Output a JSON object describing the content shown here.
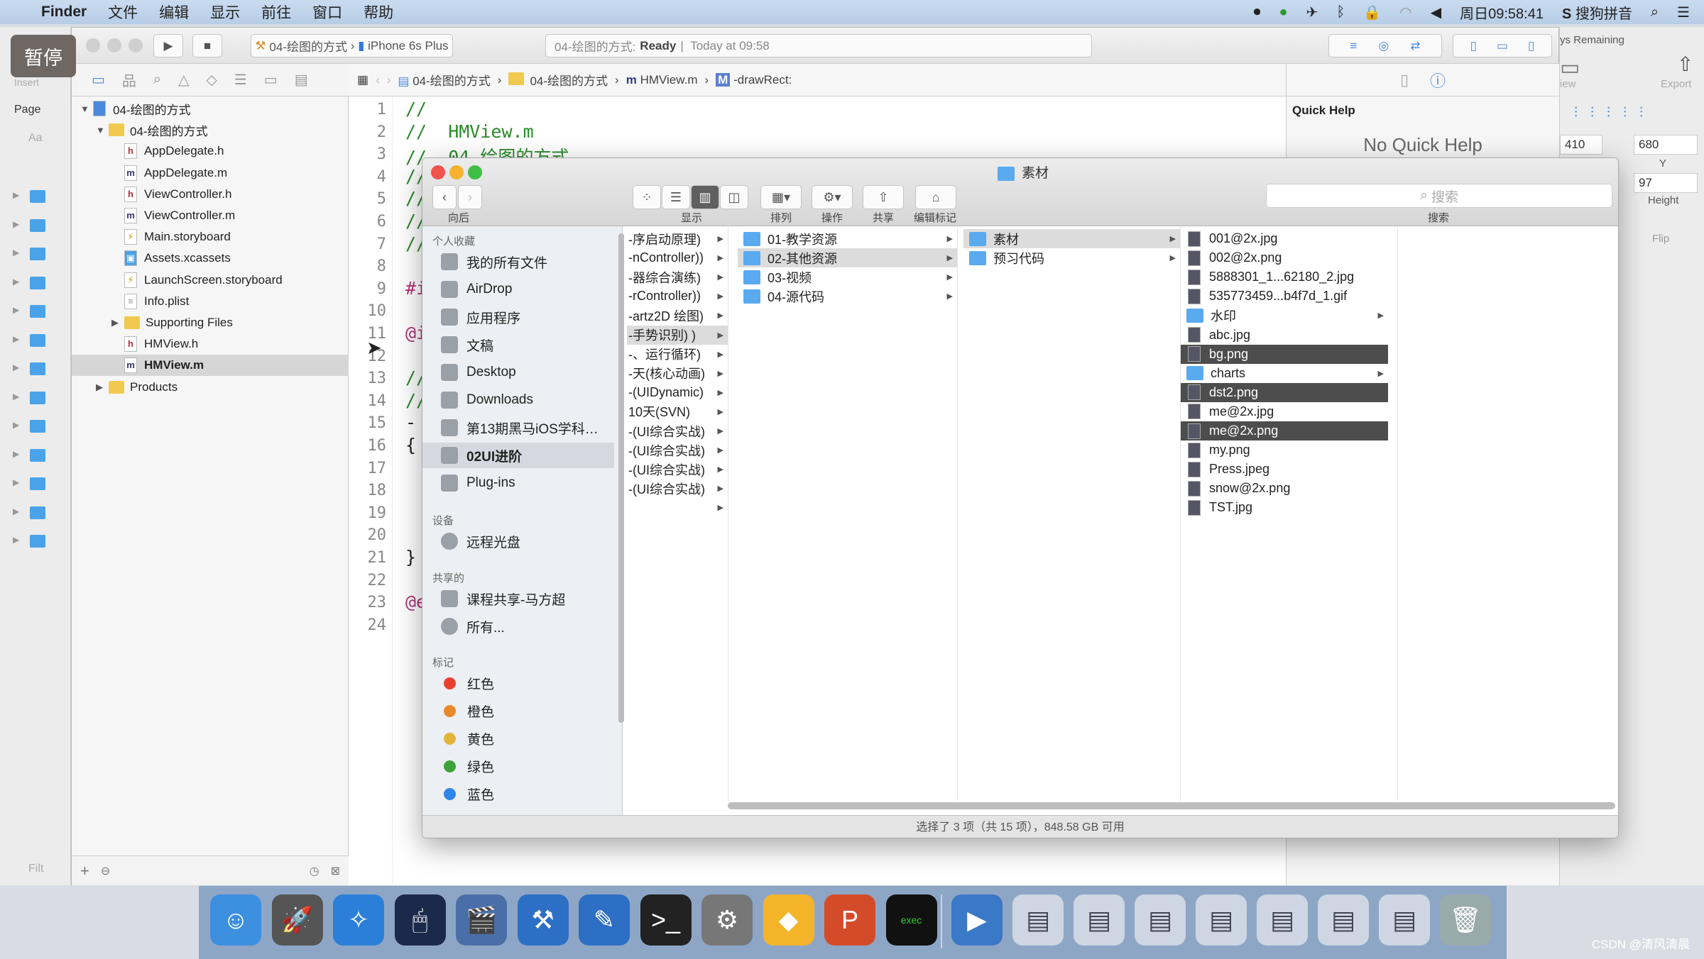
{
  "menubar": {
    "app": "Finder",
    "items": [
      "文件",
      "编辑",
      "显示",
      "前往",
      "窗口",
      "帮助"
    ],
    "clock": "周日09:58:41",
    "ime": "搜狗拼音"
  },
  "overlay": {
    "pause": "暂停",
    "watermark": "CSDN @清风清晨"
  },
  "bg_app": {
    "insert": "Insert",
    "page": "Page",
    "aa": "Aa",
    "filter": "Filt"
  },
  "xcode": {
    "scheme": "04-绘图的方式",
    "device": "iPhone 6s Plus",
    "status": {
      "project": "04-绘图的方式:",
      "state": "Ready",
      "time": "Today at 09:58"
    },
    "jumpbar": [
      "04-绘图的方式",
      "04-绘图的方式",
      "HMView.m",
      "-drawRect:"
    ],
    "navigator": [
      {
        "label": "04-绘图的方式",
        "kind": "project",
        "depth": 0,
        "open": true
      },
      {
        "label": "04-绘图的方式",
        "kind": "folder",
        "depth": 1,
        "open": true
      },
      {
        "label": "AppDelegate.h",
        "kind": "h",
        "depth": 2
      },
      {
        "label": "AppDelegate.m",
        "kind": "m",
        "depth": 2
      },
      {
        "label": "ViewController.h",
        "kind": "h",
        "depth": 2
      },
      {
        "label": "ViewController.m",
        "kind": "m",
        "depth": 2
      },
      {
        "label": "Main.storyboard",
        "kind": "sb",
        "depth": 2
      },
      {
        "label": "Assets.xcassets",
        "kind": "assets",
        "depth": 2
      },
      {
        "label": "LaunchScreen.storyboard",
        "kind": "sb",
        "depth": 2
      },
      {
        "label": "Info.plist",
        "kind": "plist",
        "depth": 2
      },
      {
        "label": "Supporting Files",
        "kind": "folder",
        "depth": 2,
        "open": false
      },
      {
        "label": "HMView.h",
        "kind": "h",
        "depth": 2
      },
      {
        "label": "HMView.m",
        "kind": "m",
        "depth": 2,
        "selected": true
      },
      {
        "label": "Products",
        "kind": "folder",
        "depth": 1,
        "open": false
      }
    ],
    "code_lines": [
      "//",
      "//  HMView.m",
      "//  04-绘图的方式",
      "//",
      "//",
      "//",
      "//",
      "",
      "#i",
      "",
      "@i",
      "",
      "//",
      "//",
      "-",
      "{",
      "",
      "",
      "",
      "",
      "}",
      "",
      "@e",
      ""
    ],
    "quick_help": {
      "title": "Quick Help",
      "empty": "No Quick Help"
    }
  },
  "sketch_panel": {
    "trial": "ys Remaining",
    "view": "iew",
    "export": "Export",
    "x_value": "410",
    "y_value": "680",
    "y_label": "Y",
    "height_value": "97",
    "height_label": "Height",
    "flip": "Flip"
  },
  "finder": {
    "title": "素材",
    "toolbar": {
      "back": "向后",
      "view": "显示",
      "arrange": "排列",
      "action": "操作",
      "share": "共享",
      "tags": "编辑标记",
      "search_placeholder": "搜索",
      "search_label": "搜索"
    },
    "sidebar": {
      "favorites_header": "个人收藏",
      "favorites": [
        "我的所有文件",
        "AirDrop",
        "应用程序",
        "文稿",
        "Desktop",
        "Downloads",
        "第13期黑马iOS学科…",
        "02UI进阶",
        "Plug-ins"
      ],
      "selected": "02UI进阶",
      "devices_header": "设备",
      "devices": [
        "远程光盘"
      ],
      "shared_header": "共享的",
      "shared": [
        "课程共享-马方超",
        "所有..."
      ],
      "tags_header": "标记",
      "tags": [
        {
          "label": "红色",
          "color": "#e8402f"
        },
        {
          "label": "橙色",
          "color": "#e8892b"
        },
        {
          "label": "黄色",
          "color": "#e2b53a"
        },
        {
          "label": "绿色",
          "color": "#3ea238"
        },
        {
          "label": "蓝色",
          "color": "#2f86e8"
        }
      ]
    },
    "columns": [
      {
        "items": [
          "-序启动原理)",
          "-nController))",
          "-器综合演练)",
          "-rController))",
          "-artz2D 绘图)",
          "-手势识别) )",
          "-、运行循环)",
          "-天(核心动画)",
          "-(UIDynamic)",
          "10天(SVN)",
          "-(UI综合实战)",
          "-(UI综合实战)",
          "-(UI综合实战)",
          "-(UI综合实战)",
          ""
        ],
        "selected": 5
      },
      {
        "items": [
          "01-教学资源",
          "02-其他资源",
          "03-视频",
          "04-源代码"
        ],
        "selected": 1
      },
      {
        "items": [
          "素材",
          "预习代码"
        ],
        "selected": 0
      },
      {
        "items": [
          {
            "name": "001@2x.jpg"
          },
          {
            "name": "002@2x.png"
          },
          {
            "name": "5888301_1...62180_2.jpg"
          },
          {
            "name": "535773459...b4f7d_1.gif"
          },
          {
            "name": "水印",
            "folder": true
          },
          {
            "name": "abc.jpg"
          },
          {
            "name": "bg.png",
            "selected": true
          },
          {
            "name": "charts",
            "folder": true
          },
          {
            "name": "dst2.png",
            "selected": true
          },
          {
            "name": "me@2x.jpg"
          },
          {
            "name": "me@2x.png",
            "selected": true
          },
          {
            "name": "my.png"
          },
          {
            "name": "Press.jpeg"
          },
          {
            "name": "snow@2x.png"
          },
          {
            "name": "TST.jpg"
          }
        ]
      }
    ],
    "status": "选择了 3 项（共 15 项），848.58 GB 可用"
  },
  "dock": [
    {
      "name": "finder",
      "glyph": "☺",
      "color": "#3d8fe0"
    },
    {
      "name": "launchpad",
      "glyph": "🚀",
      "color": "#555"
    },
    {
      "name": "safari",
      "glyph": "✧",
      "color": "#2b7fd8"
    },
    {
      "name": "cursor-app",
      "glyph": "🖱",
      "color": "#1b2a4a"
    },
    {
      "name": "keynote",
      "glyph": "🎬",
      "color": "#4a6fa8"
    },
    {
      "name": "xcode",
      "glyph": "⚒",
      "color": "#2d6fc4"
    },
    {
      "name": "instruments",
      "glyph": "✎",
      "color": "#2d6fc4"
    },
    {
      "name": "terminal",
      "glyph": ">_",
      "color": "#222"
    },
    {
      "name": "system-preferences",
      "glyph": "⚙",
      "color": "#777"
    },
    {
      "name": "sketch",
      "glyph": "◆",
      "color": "#f4b42a"
    },
    {
      "name": "powerpoint",
      "glyph": "P",
      "color": "#d44b2a"
    },
    {
      "name": "console",
      "glyph": "exec",
      "color": "#111"
    },
    {
      "name": "quicktime",
      "glyph": "▶",
      "color": "#3a78c8"
    },
    {
      "name": "window-1",
      "glyph": "▤",
      "color": "#cdd6e2"
    },
    {
      "name": "window-2",
      "glyph": "▤",
      "color": "#cdd6e2"
    },
    {
      "name": "window-3",
      "glyph": "▤",
      "color": "#cdd6e2"
    },
    {
      "name": "window-4",
      "glyph": "▤",
      "color": "#cdd6e2"
    },
    {
      "name": "window-5",
      "glyph": "▤",
      "color": "#cdd6e2"
    },
    {
      "name": "window-6",
      "glyph": "▤",
      "color": "#cdd6e2"
    },
    {
      "name": "window-7",
      "glyph": "▤",
      "color": "#cdd6e2"
    },
    {
      "name": "trash",
      "glyph": "🗑",
      "color": "#9aa"
    }
  ]
}
